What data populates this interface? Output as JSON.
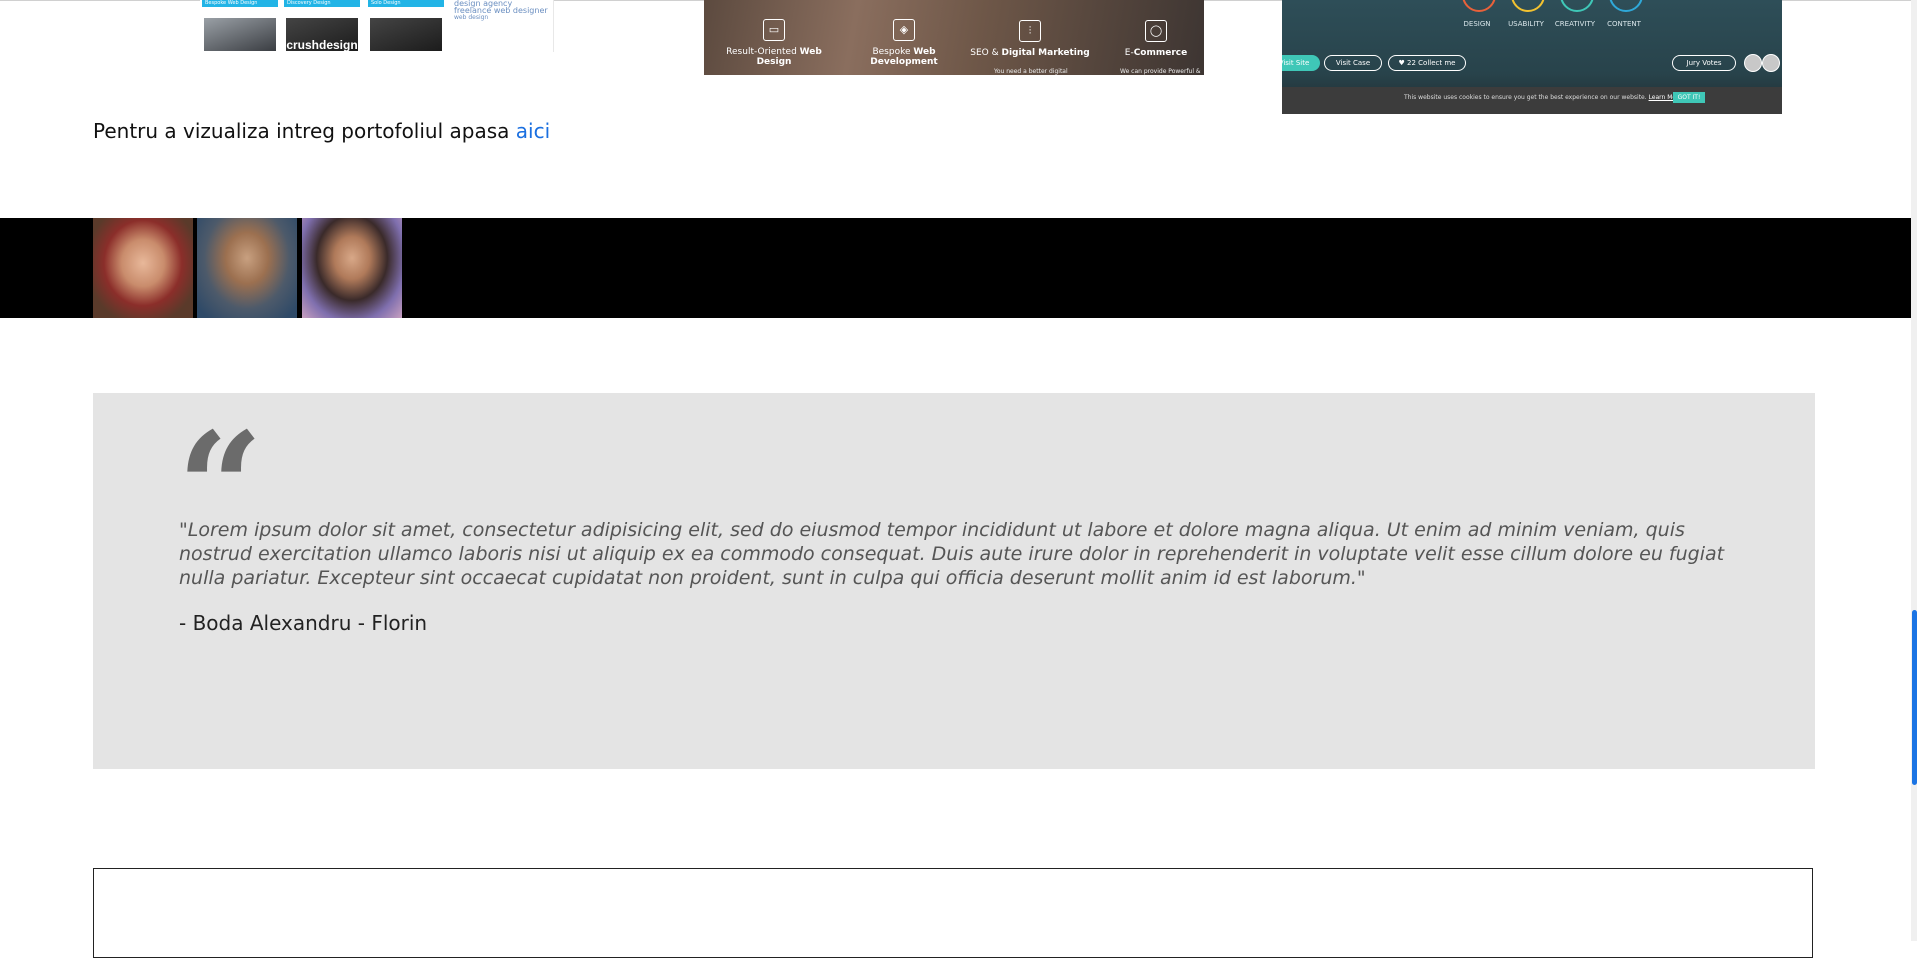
{
  "portfolio": {
    "thumb1": {
      "col_titles": [
        "Bespoke Web Design",
        "Discovery Design",
        "Solo Design"
      ],
      "brand_word": "crushdesign",
      "tags_line1": "design agency",
      "tags_line2": "freelance web designer",
      "tags_line3": "web design"
    },
    "thumb2": {
      "services": [
        {
          "pre": "Result-Oriented ",
          "bold": "Web Design",
          "icon": "monitor-icon",
          "glyph": "▭"
        },
        {
          "pre": "Bespoke ",
          "bold": "Web Development",
          "icon": "layers-icon",
          "glyph": "◈"
        },
        {
          "pre": "SEO & ",
          "bold": "Digital Marketing",
          "icon": "sliders-icon",
          "glyph": "⫶"
        },
        {
          "pre": "E-",
          "bold": "Commerce",
          "icon": "lightbulb-icon",
          "glyph": "◯"
        }
      ],
      "sub1": "You need a better digital",
      "sub2": "We can provide Powerful &"
    },
    "thumb3": {
      "labels": [
        "DESIGN",
        "USABILITY",
        "CREATIVITY",
        "CONTENT"
      ],
      "visit_site": "Visit Site",
      "visit_case": "Visit Case",
      "collect": "♥ 22  Collect me",
      "jury_votes": "Jury Votes",
      "cookie_text": "This website uses cookies to ensure you get the best experience on our website.",
      "cookie_link": "Learn More",
      "cookie_button": "GOT IT!",
      "circle_colors": [
        "#e8613a",
        "#f2c230",
        "#3fc7b7",
        "#2fa8d8"
      ]
    }
  },
  "portfolio_line": {
    "text": "Pentru a vizualiza intreg portofoliul apasa ",
    "link": "aici",
    "link_color": "#1a6fe0"
  },
  "testimonial": {
    "quote_mark": "“",
    "text": "\"Lorem ipsum dolor sit amet, consectetur adipisicing elit, sed do eiusmod tempor incididunt ut labore et dolore magna aliqua. Ut enim ad minim veniam, quis nostrud exercitation ullamco laboris nisi ut aliquip ex ea commodo consequat. Duis aute irure dolor in reprehenderit in voluptate velit esse cillum dolore eu fugiat nulla pariatur. Excepteur sint occaecat cupidatat non proident, sunt in culpa qui officia deserunt mollit anim id est laborum.\"",
    "author": "- Boda Alexandru - Florin",
    "background": "#e4e4e4"
  },
  "colors": {
    "accent": "#1b74e4",
    "strip": "#000000",
    "teal": "#3fc7b7"
  }
}
